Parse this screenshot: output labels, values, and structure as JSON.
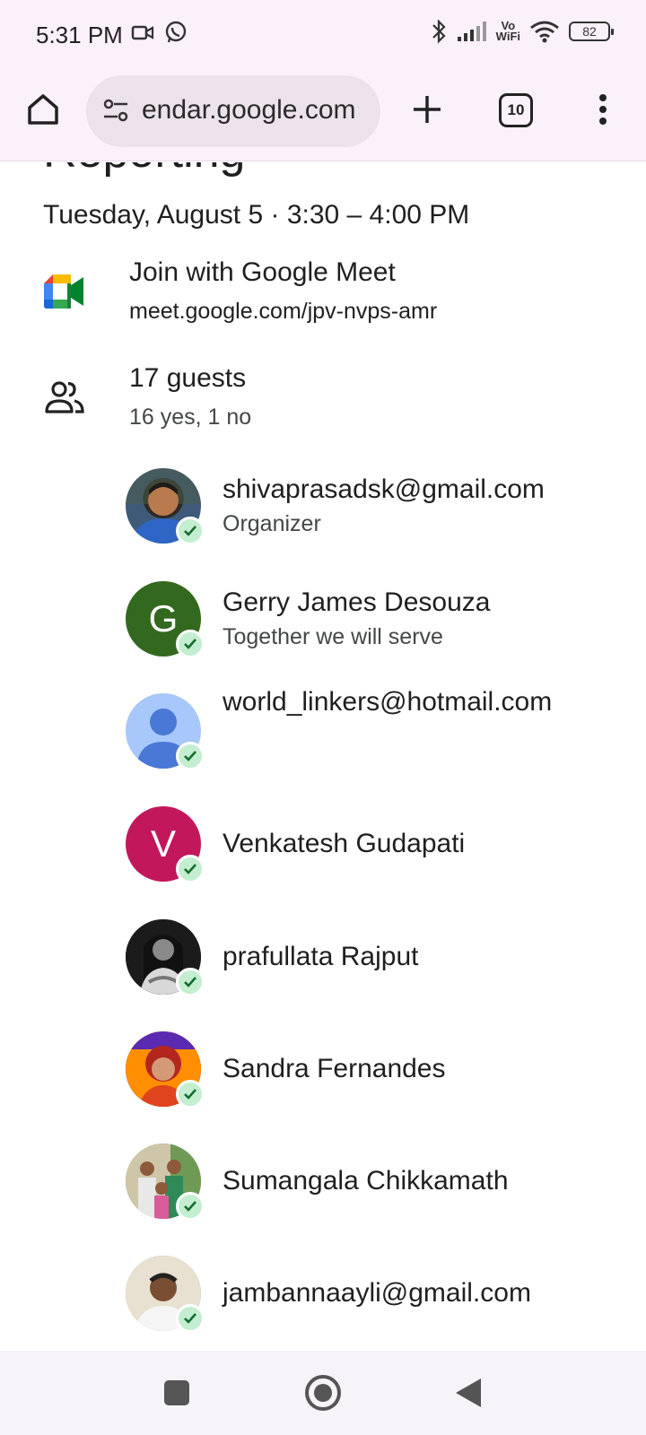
{
  "status_bar": {
    "time": "5:31 PM",
    "vowifi_line1": "Vo",
    "vowifi_line2": "WiFi",
    "battery": "82"
  },
  "browser": {
    "url": "endar.google.com",
    "tab_count": "10"
  },
  "event": {
    "title": "Reporting",
    "when": "Tuesday, August 5  ·  3:30 – 4:00 PM",
    "meet": {
      "title": "Join with Google Meet",
      "link": "meet.google.com/jpv-nvps-amr"
    },
    "guests": {
      "title": "17 guests",
      "summary": "16 yes, 1 no",
      "list": [
        {
          "name": "shivaprasadsk@gmail.com",
          "sub": "Organizer",
          "initial": "",
          "color": "#5b7fa8"
        },
        {
          "name": "Gerry James Desouza",
          "sub": "Together we will serve",
          "initial": "G",
          "color": "#33691e"
        },
        {
          "name": "world_linkers@hotmail.com",
          "sub": "",
          "initial": "",
          "color": "#a8c7fa"
        },
        {
          "name": "Venkatesh Gudapati",
          "sub": "",
          "initial": "V",
          "color": "#c2185b"
        },
        {
          "name": "prafullata Rajput",
          "sub": "",
          "initial": "",
          "color": "#333333"
        },
        {
          "name": "Sandra Fernandes",
          "sub": "",
          "initial": "",
          "color": "#e65100"
        },
        {
          "name": "Sumangala Chikkamath",
          "sub": "",
          "initial": "",
          "color": "#6d8f5e"
        },
        {
          "name": "jambannaayli@gmail.com",
          "sub": "",
          "initial": "",
          "color": "#a1887f"
        }
      ]
    }
  }
}
